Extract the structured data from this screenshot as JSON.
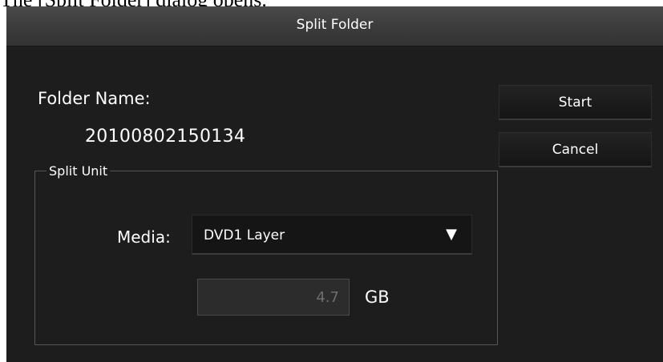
{
  "caption": "The [Split Folder] dialog opens.",
  "dialog": {
    "title": "Split Folder",
    "folder_name_label": "Folder Name:",
    "folder_name_value": "20100802150134",
    "split_unit": {
      "legend": "Split Unit",
      "media_label": "Media:",
      "media_selected": "DVD1 Layer",
      "size_value": "4.7",
      "size_unit": "GB"
    },
    "buttons": {
      "start": "Start",
      "cancel": "Cancel"
    }
  },
  "icons": {
    "dropdown_arrow": "triangle-down-icon"
  },
  "colors": {
    "dialog_bg": "#1d1d1d",
    "titlebar_bg": "#3e3e3e",
    "text": "#ffffff",
    "disabled_text": "#6e6e6e"
  }
}
